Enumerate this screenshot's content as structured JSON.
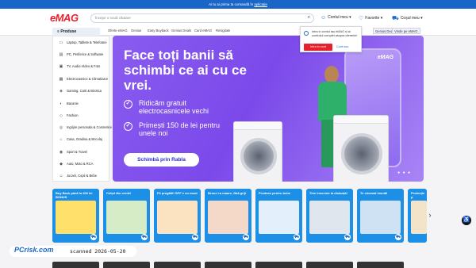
{
  "topbar": {
    "text": "Ai tu ai prima ta comandă în",
    "link": "aplicație"
  },
  "header": {
    "logo": "eMAG",
    "search_placeholder": "Începe o nouă căutare",
    "account": "Contul meu",
    "favorites": "Favorite",
    "cart": "Coșul meu"
  },
  "nav": {
    "products": "Produse",
    "links": [
      "Oferte eMAG",
      "Genius",
      "Easy Buyback",
      "Genius Deals",
      "Card eMAG",
      "Resigilate"
    ],
    "right": [
      "Genius Deals",
      "Vinde pe eMAG"
    ]
  },
  "sidebar": {
    "items": [
      {
        "icon": "laptop-icon",
        "glyph": "▭",
        "label": "Laptop, Tablete & Telefoane"
      },
      {
        "icon": "pc-icon",
        "glyph": "▤",
        "label": "PC, Periferice & Software"
      },
      {
        "icon": "tv-icon",
        "glyph": "▣",
        "label": "TV, Audio-Video & Foto"
      },
      {
        "icon": "appliance-icon",
        "glyph": "▦",
        "label": "Electrocasnice & Climatizare"
      },
      {
        "icon": "gaming-icon",
        "glyph": "◈",
        "label": "Gaming, Carti & Birotica"
      },
      {
        "icon": "grocery-icon",
        "glyph": "◐",
        "label": "Bacanie"
      },
      {
        "icon": "fashion-icon",
        "glyph": "◇",
        "label": "Fashion"
      },
      {
        "icon": "care-icon",
        "glyph": "◎",
        "label": "Ingrijire personala & Cosmetice"
      },
      {
        "icon": "home-icon",
        "glyph": "⌂",
        "label": "Casa, Gradina & Bricolaj"
      },
      {
        "icon": "sport-icon",
        "glyph": "◉",
        "label": "Sport & Travel"
      },
      {
        "icon": "auto-icon",
        "glyph": "◆",
        "label": "Auto, Moto & RCA"
      },
      {
        "icon": "toys-icon",
        "glyph": "☺",
        "label": "Jucarii, Copii & Bebe"
      }
    ]
  },
  "hero": {
    "title": "Face toți banii să schimbi ce ai cu ce vrei.",
    "bullets": [
      "Ridicăm gratuit electrocasnicele vechi",
      "Primești 150 de lei pentru unele noi"
    ],
    "cta": "Schimbă prin Rabla",
    "phone_logo": "eMAG"
  },
  "popup": {
    "text": "Intra in contul tau eMAG si ai controlul complet asupra ofertelor!",
    "button": "Intra in cont",
    "link": "Cont nou"
  },
  "cards": [
    "Buy Back până la 400 lei BONUS",
    "Celțul tău verde!",
    "Fii pregătit! SPF e un must",
    "Bronz La maare, fără griji",
    "Produse pentru bebe",
    "Tine înecrede la distanță!",
    "Te cheamă insulă!",
    "Protecție p"
  ],
  "watermark": {
    "logo": "PCrisk.com",
    "text": "scanned 2026-05-20"
  }
}
